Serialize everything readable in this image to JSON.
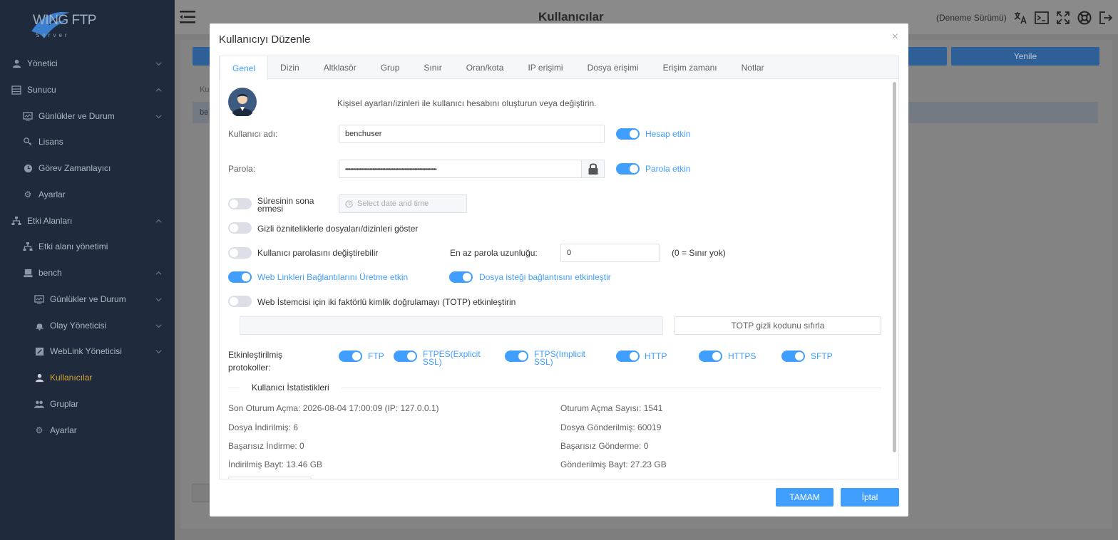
{
  "app": {
    "logo_text": "WING FTP",
    "logo_sub": "Server",
    "page_title": "Kullanıcılar",
    "trial": "(Deneme Sürümü)"
  },
  "sidebar": {
    "items": [
      {
        "label": "Yönetici",
        "icon": "user-icon"
      },
      {
        "label": "Sunucu",
        "icon": "server-icon"
      },
      {
        "label": "Günlükler ve Durum",
        "icon": "monitor-icon"
      },
      {
        "label": "Lisans",
        "icon": "key-icon"
      },
      {
        "label": "Görev Zamanlayıcı",
        "icon": "clock-icon"
      },
      {
        "label": "Ayarlar",
        "icon": "gear-icon"
      },
      {
        "label": "Etki Alanları",
        "icon": "sitemap-icon"
      },
      {
        "label": "Etki alanı yönetimi",
        "icon": "sitemap-icon"
      },
      {
        "label": "bench",
        "icon": "domain-icon"
      },
      {
        "label": "Günlükler ve Durum",
        "icon": "monitor-icon"
      },
      {
        "label": "Olay Yöneticisi",
        "icon": "bell-icon"
      },
      {
        "label": "WebLink Yöneticisi",
        "icon": "link-icon"
      },
      {
        "label": "Kullanıcılar",
        "icon": "user-icon"
      },
      {
        "label": "Gruplar",
        "icon": "users-icon"
      },
      {
        "label": "Ayarlar",
        "icon": "gear-icon"
      }
    ]
  },
  "background": {
    "refresh_label": "Yenile",
    "col_header_fragment": "Ku",
    "row_fragment": "be"
  },
  "modal": {
    "title": "Kullanıcıyı Düzenle",
    "close_glyph": "×",
    "tabs": [
      "Genel",
      "Dizin",
      "Altklasör",
      "Grup",
      "Sınır",
      "Oran/kota",
      "IP erişimi",
      "Dosya erişimi",
      "Erişim zamanı",
      "Notlar"
    ],
    "description": "Kişisel ayarları/izinleri ile kullanıcı hesabını oluşturun veya değiştirin.",
    "username_label": "Kullanıcı adı:",
    "username_value": "benchuser",
    "account_enabled": "Hesap etkin",
    "password_label": "Parola:",
    "password_value": "•••••••••••••••••••••••••••••••••••••••••••••••••••••••••••••••••••••••",
    "password_enabled": "Parola etkin",
    "expire_label_1": "Süresinin sona",
    "expire_label_2": "ermesi",
    "date_placeholder": "Select date and time",
    "hidden_files": "Gizli özniteliklerle dosyaları/dizinleri göster",
    "can_change_password": "Kullanıcı parolasını değiştirebilir",
    "min_password_label": "En az parola uzunluğu:",
    "min_password_value": "0",
    "min_password_hint": "(0 = Sınır yok)",
    "weblink_enabled": "Web Linkleri Bağlantılarını Üretme etkin",
    "file_request_enabled": "Dosya isteği bağlantısını etkinleştir",
    "totp_label": "Web İstemcisi için iki faktörlü kimlik doğrulamayı (TOTP) etkinleştirin",
    "totp_reset": "TOTP gizli kodunu sıfırla",
    "protocols_label_1": "Etkinleştirilmiş",
    "protocols_label_2": "protokoller:",
    "protocols": [
      {
        "name": "FTP",
        "line2": "",
        "enabled": true
      },
      {
        "name": "FTPES(Explicit",
        "line2": "SSL)",
        "enabled": true
      },
      {
        "name": "FTPS(Implicit",
        "line2": "SSL)",
        "enabled": true
      },
      {
        "name": "HTTP",
        "line2": "",
        "enabled": true
      },
      {
        "name": "HTTPS",
        "line2": "",
        "enabled": true
      },
      {
        "name": "SFTP",
        "line2": "",
        "enabled": true
      }
    ],
    "stats_title": "Kullanıcı İstatistikleri",
    "stats": {
      "last_login": "Son Oturum Açma: 2026-08-04 17:00:09 (IP: 127.0.0.1)",
      "login_count": "Oturum Açma Sayısı: 1541",
      "files_downloaded": "Dosya İndirilmiş: 6",
      "files_uploaded": "Dosya Gönderilmiş: 60019",
      "failed_downloads": "Başarısız İndirme: 0",
      "failed_uploads": "Başarısız Gönderme: 0",
      "bytes_downloaded": "İndirilmiş Bayt: 13.46 GB",
      "bytes_uploaded": "Gönderilmiş Bayt: 27.23 GB"
    },
    "ok_label": "TAMAM",
    "cancel_label": "İptal"
  },
  "colors": {
    "accent": "#409eff",
    "sidebar_bg": "#1f2a3c",
    "active_nav": "#d4a531"
  }
}
